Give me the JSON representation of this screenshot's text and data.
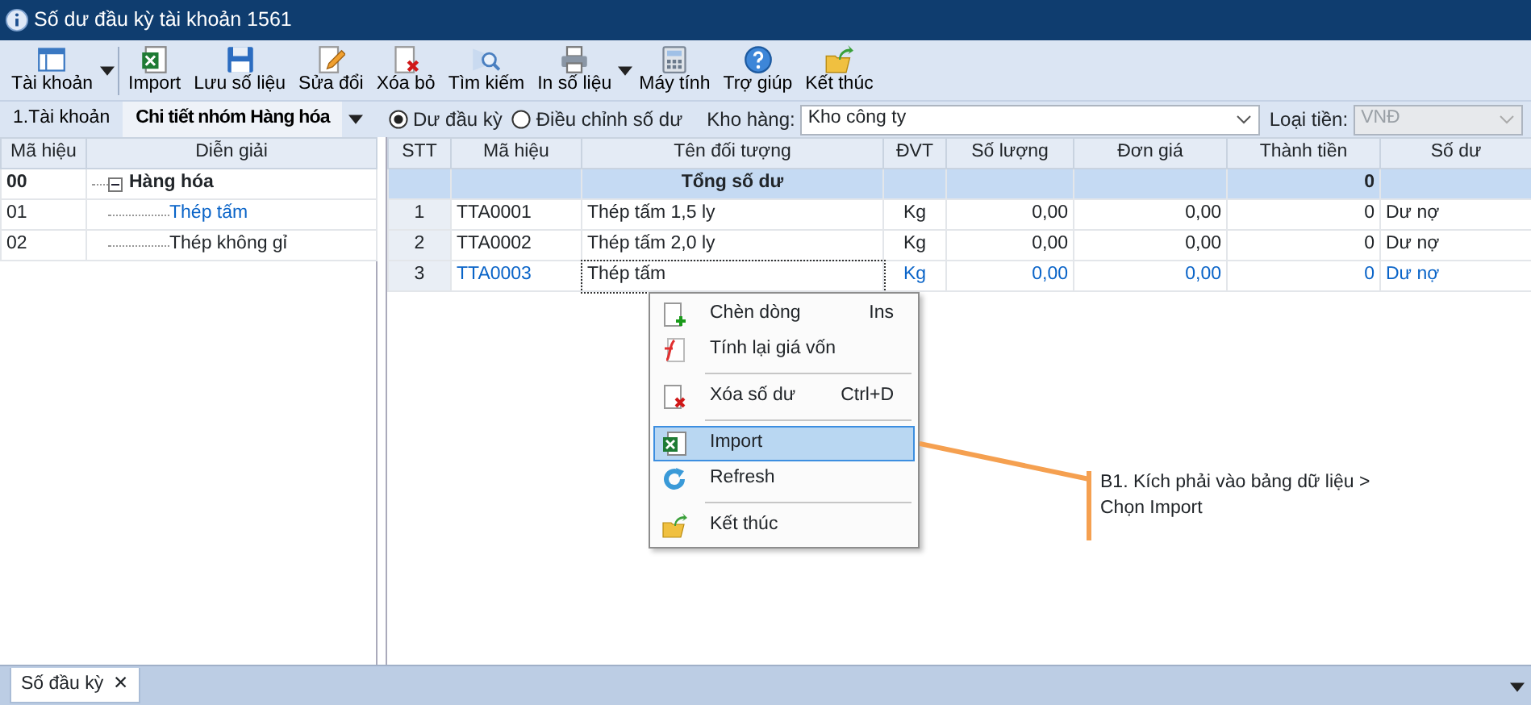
{
  "window": {
    "title": "Số dư đầu kỳ tài khoản 1561"
  },
  "toolbar": [
    {
      "label": "Tài khoản",
      "dropdown": true
    },
    {
      "label": "Import",
      "dropdown": false
    },
    {
      "label": "Lưu số liệu",
      "dropdown": false
    },
    {
      "label": "Sửa đổi",
      "dropdown": false
    },
    {
      "label": "Xóa bỏ",
      "dropdown": false
    },
    {
      "label": "Tìm kiếm",
      "dropdown": false
    },
    {
      "label": "In số liệu",
      "dropdown": true
    },
    {
      "label": "Máy tính",
      "dropdown": false
    },
    {
      "label": "Trợ giúp",
      "dropdown": false
    },
    {
      "label": "Kết thúc",
      "dropdown": false
    }
  ],
  "left_tabs": [
    {
      "label": "1.Tài khoản",
      "selected": false
    },
    {
      "label": "Chi tiết nhóm Hàng hóa",
      "selected": true
    }
  ],
  "radios": [
    {
      "label": "Dư đầu kỳ",
      "selected": true
    },
    {
      "label": "Điều chỉnh số dư",
      "selected": false
    }
  ],
  "warehouse": {
    "label": "Kho hàng:",
    "value": "Kho công ty"
  },
  "currency": {
    "label": "Loại tiền:",
    "value": "VNĐ",
    "disabled": true
  },
  "left_table": {
    "columns": [
      "Mã hiệu",
      "Diễn giải"
    ],
    "rows": [
      {
        "code": "00",
        "name": "Hàng hóa",
        "expanded": true,
        "selected": false,
        "children": [
          {
            "code": "01",
            "name": "Thép tấm",
            "selected": true
          },
          {
            "code": "02",
            "name": "Thép không gỉ",
            "selected": false
          }
        ]
      }
    ]
  },
  "main_table": {
    "columns": [
      "STT",
      "Mã hiệu",
      "Tên đối tượng",
      "ĐVT",
      "Số lượng",
      "Đơn giá",
      "Thành tiền",
      "Số dư"
    ],
    "total_row": {
      "label": "Tổng số dư",
      "amount": "0"
    },
    "rows": [
      {
        "stt": "1",
        "code": "TTA0001",
        "name": "Thép tấm 1,5 ly",
        "unit": "Kg",
        "quantity": "0,00",
        "unit_price": "0,00",
        "amount": "0",
        "balance": "Dư nợ",
        "selected": false
      },
      {
        "stt": "2",
        "code": "TTA0002",
        "name": "Thép tấm 2,0 ly",
        "unit": "Kg",
        "quantity": "0,00",
        "unit_price": "0,00",
        "amount": "0",
        "balance": "Dư nợ",
        "selected": false
      },
      {
        "stt": "3",
        "code": "TTA0003",
        "name": "Thép tấm",
        "unit": "Kg",
        "quantity": "0,00",
        "unit_price": "0,00",
        "amount": "0",
        "balance": "Dư nợ",
        "selected": true
      }
    ]
  },
  "context_menu": {
    "groups": [
      {
        "items": [
          {
            "label": "Chèn dòng",
            "shortcut": "Ins",
            "selected": false
          },
          {
            "label": "Tính lại giá vốn",
            "selected": false
          }
        ]
      },
      {
        "items": [
          {
            "label": "Xóa số dư",
            "shortcut": "Ctrl+D",
            "selected": false
          }
        ]
      },
      {
        "items": [
          {
            "label": "Import",
            "selected": true
          },
          {
            "label": "Refresh",
            "selected": false
          }
        ]
      },
      {
        "items": [
          {
            "label": "Kết thúc",
            "selected": false
          }
        ]
      }
    ]
  },
  "annotation": {
    "text": "B1. Kích phải vào bảng dữ liệu > Chọn Import"
  },
  "bottom_tabs": [
    {
      "label": "Số đầu kỳ",
      "close": "✕"
    }
  ]
}
